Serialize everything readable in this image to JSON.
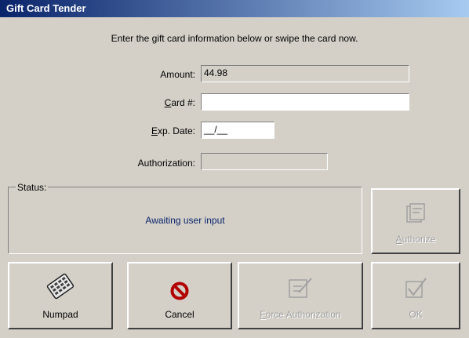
{
  "window": {
    "title": "Gift Card Tender"
  },
  "instruction": "Enter the gift card information below or swipe the card now.",
  "form": {
    "amount": {
      "label": "Amount:",
      "value": "44.98"
    },
    "card": {
      "label_mnemonic": "C",
      "label_rest": "ard #:",
      "value": ""
    },
    "exp": {
      "label_mnemonic": "E",
      "label_rest": "xp. Date:",
      "value": "__/__"
    },
    "authorization": {
      "label": "Authorization:",
      "value": ""
    }
  },
  "status": {
    "legend": "Status:",
    "message": "Awaiting user input"
  },
  "buttons": {
    "authorize": {
      "mnemonic": "A",
      "rest": "uthorize"
    },
    "numpad": {
      "label": "Numpad"
    },
    "cancel": {
      "label": "Cancel"
    },
    "force": {
      "mnemonic": "F",
      "rest": "orce Authorization"
    },
    "ok": {
      "label": "OK"
    }
  }
}
